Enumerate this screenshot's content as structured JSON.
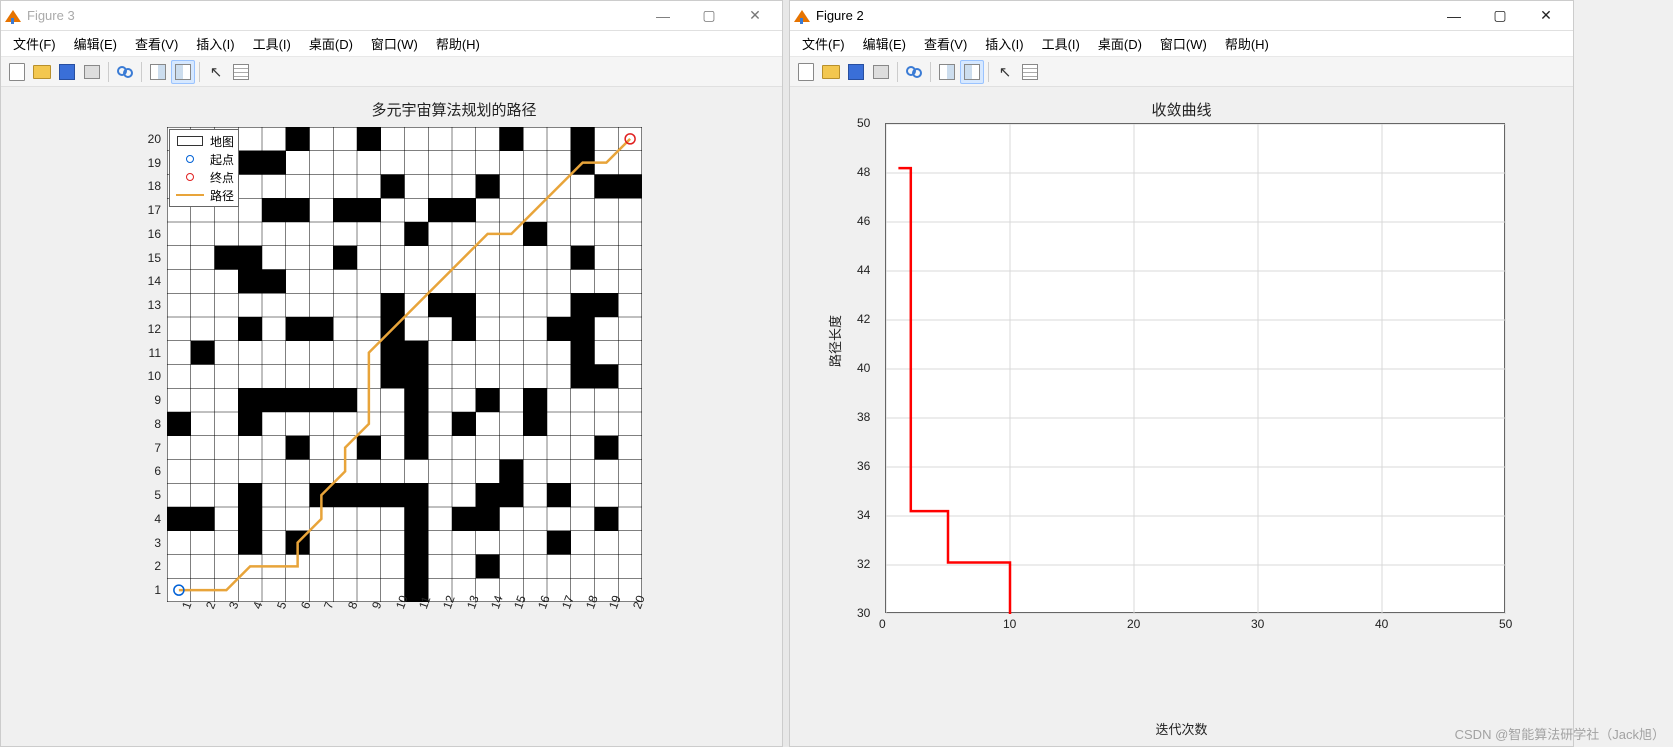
{
  "watermark": "CSDN @智能算法研学社（Jack旭）",
  "figure3": {
    "title": "Figure 3",
    "active": false,
    "menus": [
      "文件(F)",
      "编辑(E)",
      "查看(V)",
      "插入(I)",
      "工具(I)",
      "桌面(D)",
      "窗口(W)",
      "帮助(H)"
    ],
    "plot_title": "多元宇宙算法规划的路径",
    "legend": {
      "map": "地图",
      "start": "起点",
      "end": "终点",
      "path": "路径"
    }
  },
  "figure2": {
    "title": "Figure 2",
    "active": true,
    "menus": [
      "文件(F)",
      "编辑(E)",
      "查看(V)",
      "插入(I)",
      "工具(I)",
      "桌面(D)",
      "窗口(W)",
      "帮助(H)"
    ],
    "plot_title": "收敛曲线",
    "xlabel": "迭代次数",
    "ylabel": "路径长度"
  },
  "chart_data": [
    {
      "id": "figure3_map",
      "type": "heatmap",
      "title": "多元宇宙算法规划的路径",
      "xlabel": "",
      "ylabel": "",
      "xlim": [
        1,
        20
      ],
      "ylim": [
        1,
        20
      ],
      "grid_size": 20,
      "obstacles_rowcol": [
        [
          1,
          11
        ],
        [
          2,
          11
        ],
        [
          2,
          14
        ],
        [
          3,
          4
        ],
        [
          3,
          6
        ],
        [
          3,
          11
        ],
        [
          3,
          17
        ],
        [
          4,
          1
        ],
        [
          4,
          2
        ],
        [
          4,
          4
        ],
        [
          4,
          11
        ],
        [
          4,
          13
        ],
        [
          4,
          14
        ],
        [
          4,
          19
        ],
        [
          5,
          4
        ],
        [
          5,
          7
        ],
        [
          5,
          8
        ],
        [
          5,
          9
        ],
        [
          5,
          10
        ],
        [
          5,
          11
        ],
        [
          5,
          14
        ],
        [
          5,
          15
        ],
        [
          5,
          17
        ],
        [
          6,
          15
        ],
        [
          7,
          6
        ],
        [
          7,
          9
        ],
        [
          7,
          11
        ],
        [
          7,
          19
        ],
        [
          8,
          1
        ],
        [
          8,
          4
        ],
        [
          8,
          11
        ],
        [
          8,
          13
        ],
        [
          8,
          16
        ],
        [
          9,
          4
        ],
        [
          9,
          5
        ],
        [
          9,
          6
        ],
        [
          9,
          7
        ],
        [
          9,
          8
        ],
        [
          9,
          11
        ],
        [
          9,
          14
        ],
        [
          9,
          16
        ],
        [
          10,
          10
        ],
        [
          10,
          11
        ],
        [
          10,
          18
        ],
        [
          10,
          19
        ],
        [
          11,
          2
        ],
        [
          11,
          10
        ],
        [
          11,
          11
        ],
        [
          11,
          18
        ],
        [
          12,
          4
        ],
        [
          12,
          6
        ],
        [
          12,
          7
        ],
        [
          12,
          10
        ],
        [
          12,
          13
        ],
        [
          12,
          17
        ],
        [
          12,
          18
        ],
        [
          13,
          10
        ],
        [
          13,
          12
        ],
        [
          13,
          13
        ],
        [
          13,
          18
        ],
        [
          13,
          19
        ],
        [
          14,
          4
        ],
        [
          14,
          5
        ],
        [
          15,
          3
        ],
        [
          15,
          4
        ],
        [
          15,
          8
        ],
        [
          15,
          18
        ],
        [
          16,
          11
        ],
        [
          16,
          16
        ],
        [
          17,
          5
        ],
        [
          17,
          6
        ],
        [
          17,
          8
        ],
        [
          17,
          9
        ],
        [
          17,
          12
        ],
        [
          17,
          13
        ],
        [
          18,
          2
        ],
        [
          18,
          10
        ],
        [
          18,
          14
        ],
        [
          18,
          19
        ],
        [
          18,
          20
        ],
        [
          19,
          4
        ],
        [
          19,
          5
        ],
        [
          19,
          18
        ],
        [
          20,
          6
        ],
        [
          20,
          9
        ],
        [
          20,
          15
        ],
        [
          20,
          18
        ]
      ],
      "start": [
        1,
        1
      ],
      "end": [
        20,
        20
      ],
      "path_xy": [
        [
          1,
          1
        ],
        [
          2,
          1
        ],
        [
          3,
          1
        ],
        [
          4,
          2
        ],
        [
          5,
          2
        ],
        [
          6,
          2
        ],
        [
          6,
          3
        ],
        [
          7,
          4
        ],
        [
          7,
          5
        ],
        [
          8,
          6
        ],
        [
          8,
          7
        ],
        [
          9,
          8
        ],
        [
          9,
          9
        ],
        [
          9,
          10
        ],
        [
          9,
          11
        ],
        [
          10,
          12
        ],
        [
          11,
          13
        ],
        [
          12,
          14
        ],
        [
          13,
          15
        ],
        [
          14,
          16
        ],
        [
          15,
          16
        ],
        [
          16,
          17
        ],
        [
          17,
          18
        ],
        [
          18,
          19
        ],
        [
          19,
          19
        ],
        [
          20,
          20
        ]
      ]
    },
    {
      "id": "figure2_convergence",
      "type": "line",
      "title": "收敛曲线",
      "xlabel": "迭代次数",
      "ylabel": "路径长度",
      "xlim": [
        0,
        50
      ],
      "ylim": [
        30,
        50
      ],
      "xticks": [
        0,
        10,
        20,
        30,
        40,
        50
      ],
      "yticks": [
        30,
        32,
        34,
        36,
        38,
        40,
        42,
        44,
        46,
        48,
        50
      ],
      "series": [
        {
          "name": "path-length",
          "color": "#ff0000",
          "x": [
            1,
            2,
            3,
            4,
            5,
            6,
            7,
            8,
            9,
            10,
            50
          ],
          "y": [
            48.2,
            34.2,
            34.2,
            34.2,
            32.1,
            32.1,
            32.1,
            32.1,
            32.1,
            29.8,
            29.8
          ]
        }
      ]
    }
  ]
}
